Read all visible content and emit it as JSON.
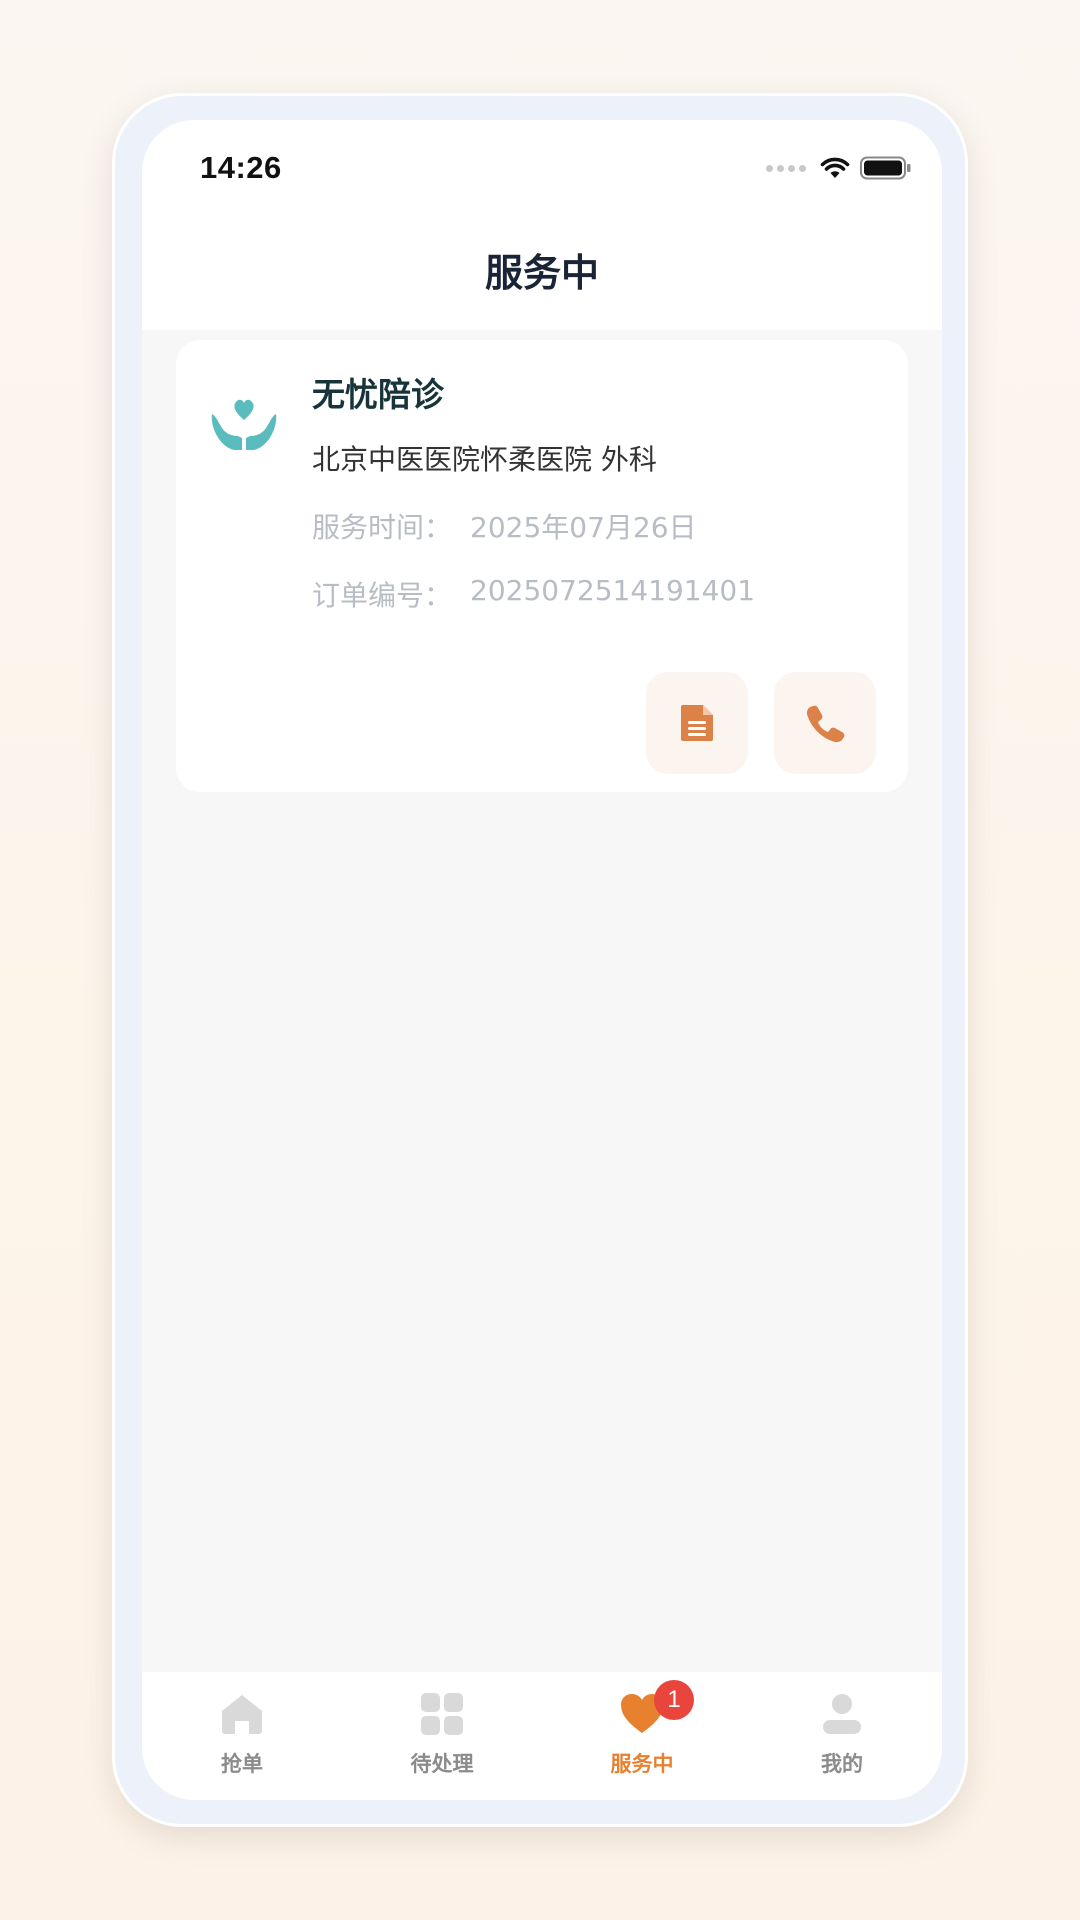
{
  "status_bar": {
    "time": "14:26"
  },
  "header": {
    "title": "服务中"
  },
  "order_card": {
    "service_name": "无忧陪诊",
    "hospital": "北京中医医院怀柔医院 外科",
    "service_time_label": "服务时间：",
    "service_time_value": "2025年07月26日",
    "order_no_label": "订单编号：",
    "order_no_value": "2025072514191401",
    "logo_icon": "care-hands-heart-icon",
    "actions": [
      {
        "icon": "document-icon"
      },
      {
        "icon": "phone-icon"
      }
    ]
  },
  "tabbar": {
    "tabs": [
      {
        "label": "抢单",
        "icon": "home-icon",
        "active": false
      },
      {
        "label": "待处理",
        "icon": "grid-icon",
        "active": false
      },
      {
        "label": "服务中",
        "icon": "heart-icon",
        "active": true,
        "badge": "1"
      },
      {
        "label": "我的",
        "icon": "person-icon",
        "active": false
      }
    ]
  },
  "colors": {
    "accent": "#e8812f",
    "badge": "#e8453c",
    "logo": "#5bbcbf",
    "title": "#1b2436"
  }
}
